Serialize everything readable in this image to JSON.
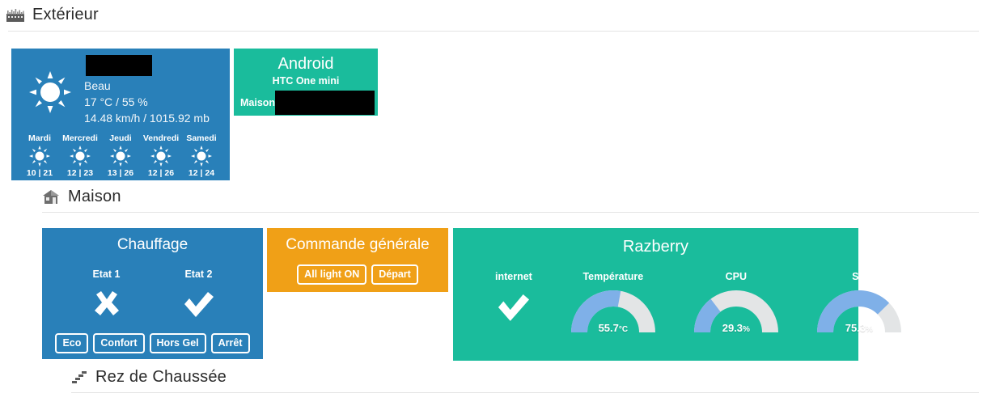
{
  "sections": [
    {
      "id": "exterieur",
      "title": "Extérieur",
      "icon": "factory-icon"
    },
    {
      "id": "maison",
      "title": "Maison",
      "icon": "house-icon"
    },
    {
      "id": "rez-de-chaussee",
      "title": "Rez de Chaussée",
      "icon": "stairs-icon"
    }
  ],
  "weather": {
    "icon": "sun-icon",
    "redacted": "",
    "condition": "Beau",
    "temp_humidity": "17 °C / 55 %",
    "wind_pressure": "14.48 km/h / 1015.92 mb",
    "forecast": [
      {
        "day": "Mardi",
        "icon": "sun-icon",
        "temps": "10 | 21"
      },
      {
        "day": "Mercredi",
        "icon": "sun-icon",
        "temps": "12 | 23"
      },
      {
        "day": "Jeudi",
        "icon": "sun-icon",
        "temps": "13 | 26"
      },
      {
        "day": "Vendredi",
        "icon": "sun-icon",
        "temps": "12 | 26"
      },
      {
        "day": "Samedi",
        "icon": "sun-icon",
        "temps": "12 | 24"
      }
    ]
  },
  "android": {
    "title": "Android",
    "model": "HTC One mini",
    "location_label": "Maison",
    "redacted": ""
  },
  "chauffage": {
    "title": "Chauffage",
    "states": [
      {
        "label": "Etat 1",
        "icon": "cross-icon",
        "value": "off"
      },
      {
        "label": "Etat 2",
        "icon": "check-icon",
        "value": "on"
      }
    ],
    "buttons": [
      "Eco",
      "Confort",
      "Hors Gel",
      "Arrêt"
    ]
  },
  "commande": {
    "title": "Commande générale",
    "buttons": [
      "All light ON",
      "Départ"
    ]
  },
  "razberry": {
    "title": "Razberry",
    "items": [
      {
        "label": "internet",
        "type": "status",
        "icon": "check-icon",
        "value": "ok"
      },
      {
        "label": "Température",
        "type": "gauge",
        "value": 55.7,
        "display": "55.7",
        "unit": "°C",
        "percent": 55.7
      },
      {
        "label": "CPU",
        "type": "gauge",
        "value": 29.3,
        "display": "29.3",
        "unit": "%",
        "percent": 29.3
      },
      {
        "label": "SD",
        "type": "gauge",
        "value": 75.3,
        "display": "75.3",
        "unit": "%",
        "percent": 75.3
      }
    ]
  },
  "colors": {
    "blue": "#2980b9",
    "green": "#1abc9c",
    "orange": "#f0a017",
    "gauge_fill": "#7fb0e8",
    "gauge_track": "#e3e5e6",
    "header_text": "#2b2b2b",
    "rule": "#e4e4e4"
  }
}
